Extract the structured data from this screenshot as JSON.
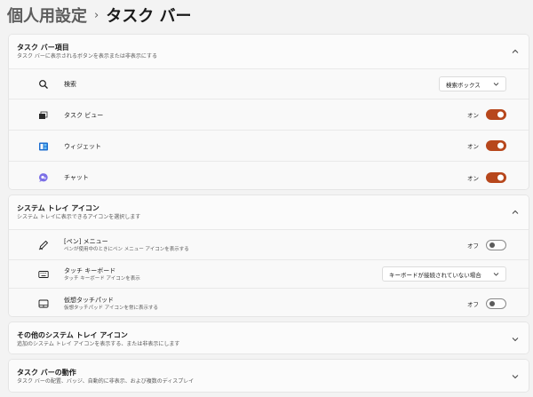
{
  "breadcrumb": {
    "parent": "個人用設定",
    "separator": "›",
    "current": "タスク バー"
  },
  "colors": {
    "accent": "#b7471c",
    "background": "#f3f3f3",
    "card": "#fbfbfb"
  },
  "sections": {
    "taskbar_items": {
      "title": "タスク バー項目",
      "subtitle": "タスク バーに表示されるボタンを表示または非表示にする",
      "expanded": true,
      "rows": [
        {
          "label": "検索",
          "icon": "search-icon",
          "control": "dropdown",
          "value": "検索ボックス"
        },
        {
          "label": "タスク ビュー",
          "icon": "task-view-icon",
          "control": "toggle",
          "state": "オン",
          "on": true
        },
        {
          "label": "ウィジェット",
          "icon": "widgets-icon",
          "control": "toggle",
          "state": "オン",
          "on": true
        },
        {
          "label": "チャット",
          "icon": "chat-icon",
          "control": "toggle",
          "state": "オン",
          "on": true
        }
      ]
    },
    "system_tray_icons": {
      "title": "システム トレイ アイコン",
      "subtitle": "システム トレイに表示できるアイコンを選択します",
      "expanded": true,
      "rows": [
        {
          "label": "[ペン] メニュー",
          "sublabel": "ペンが使用中のときにペン メニュー アイコンを表示する",
          "icon": "pen-icon",
          "control": "toggle",
          "state": "オフ",
          "on": false
        },
        {
          "label": "タッチ キーボード",
          "sublabel": "タッチ キーボード アイコンを表示",
          "icon": "keyboard-icon",
          "control": "dropdown",
          "value": "キーボードが接続されていない場合"
        },
        {
          "label": "仮想タッチパッド",
          "sublabel": "仮想タッチパッド アイコンを常に表示する",
          "icon": "touchpad-icon",
          "control": "toggle",
          "state": "オフ",
          "on": false
        }
      ]
    },
    "other_tray_icons": {
      "title": "その他のシステム トレイ アイコン",
      "subtitle": "追加のシステム トレイ アイコンを表示する、または非表示にします",
      "expanded": false
    },
    "taskbar_behaviors": {
      "title": "タスク バーの動作",
      "subtitle": "タスク バーの配置、バッジ、自動的に非表示、および複数のディスプレイ",
      "expanded": false
    }
  }
}
